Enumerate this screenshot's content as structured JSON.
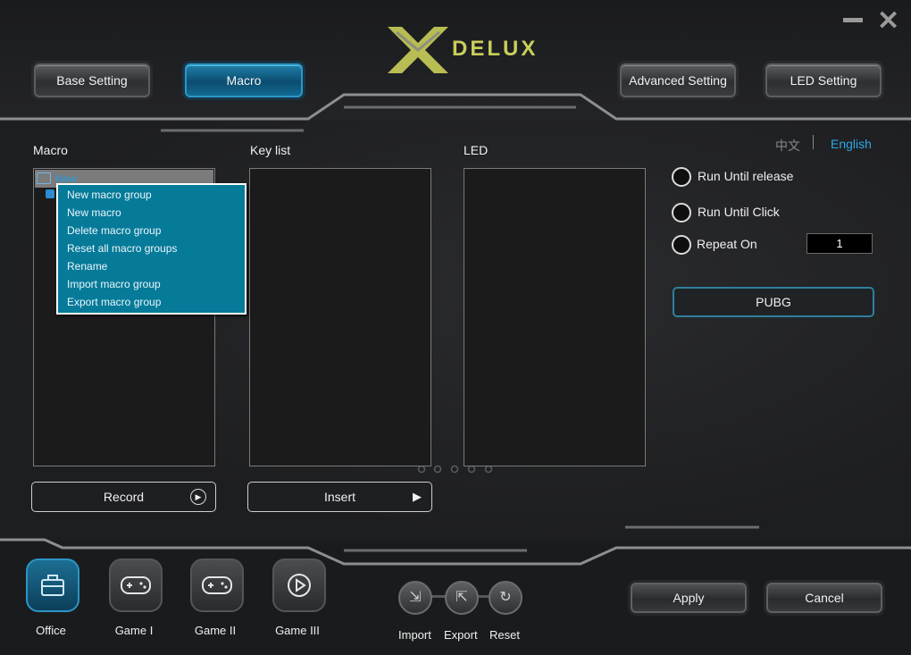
{
  "window": {
    "minimize_icon": "minimize-icon",
    "close_icon": "close-icon"
  },
  "brand": {
    "logo_text": "DELUX",
    "accent": "#c9ce5a"
  },
  "top_nav": {
    "base_setting": "Base Setting",
    "macro": "Macro",
    "advanced_setting": "Advanced Setting",
    "led_setting": "LED Setting"
  },
  "language": {
    "zh": "中文",
    "en": "English"
  },
  "panels": {
    "macro": "Macro",
    "key_list": "Key list",
    "led": "LED"
  },
  "tree": {
    "root": "New"
  },
  "context_menu": [
    "New macro group",
    "New macro",
    "Delete macro group",
    "Reset all macro groups",
    "Rename",
    "Import macro group",
    "Export macro group"
  ],
  "buttons": {
    "record": "Record",
    "insert": "Insert",
    "apply": "Apply",
    "cancel": "Cancel"
  },
  "options": {
    "run_until_release": "Run Until release",
    "run_until_click": "Run Until Click",
    "repeat_on": "Repeat On",
    "repeat_value": "1"
  },
  "profile_name": "PUBG",
  "profiles": [
    "Office",
    "Game I",
    "Game II",
    "Game III"
  ],
  "tools": {
    "import": "Import",
    "export": "Export",
    "reset": "Reset"
  }
}
